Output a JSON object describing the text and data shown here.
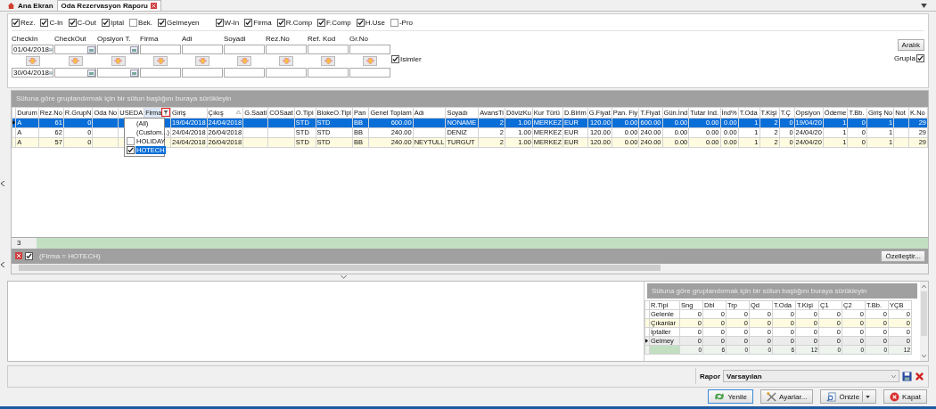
{
  "tabs": [
    {
      "label": "Ana Ekran",
      "kind": "home",
      "selected": false,
      "closable": false
    },
    {
      "label": "Oda Rezervasyon Raporu",
      "kind": "report",
      "selected": true,
      "closable": true
    }
  ],
  "status_groups": [
    {
      "checks": [
        {
          "label": "Rez.",
          "checked": true
        },
        {
          "label": "C-In",
          "checked": true
        },
        {
          "label": "C-Out",
          "checked": true
        },
        {
          "label": "Iptal",
          "checked": true
        },
        {
          "label": "Bek.",
          "checked": false
        },
        {
          "label": "Gelmeyen",
          "checked": true
        }
      ]
    },
    {
      "checks": [
        {
          "label": "W-In",
          "checked": true
        },
        {
          "label": "Firma",
          "checked": true
        },
        {
          "label": "R.Comp",
          "checked": true
        },
        {
          "label": "F.Comp",
          "checked": true
        },
        {
          "label": "H.Use",
          "checked": true
        },
        {
          "label": "-Pro",
          "checked": false
        }
      ]
    }
  ],
  "filters": [
    {
      "label": "CheckIn",
      "kind": "date",
      "from": "01/04/2018",
      "to": "30/04/2018"
    },
    {
      "label": "CheckOut",
      "kind": "date"
    },
    {
      "label": "Opsiyon T.",
      "kind": "date"
    },
    {
      "label": "Firma",
      "kind": "text"
    },
    {
      "label": "Adi",
      "kind": "text"
    },
    {
      "label": "Soyadi",
      "kind": "text"
    },
    {
      "label": "Rez.No",
      "kind": "text"
    },
    {
      "label": "Ref. Kod",
      "kind": "text"
    },
    {
      "label": "Gr.No",
      "kind": "text"
    }
  ],
  "names_check": {
    "label": "Isimler",
    "checked": true
  },
  "range_button": "Aralık",
  "group_check": {
    "label": "Grupla",
    "checked": true
  },
  "grid": {
    "group_hint": "Sütuna göre gruplandırmak için bir sütun başlığını buraya sürükleyin",
    "columns": [
      {
        "label": "Durum",
        "kind": "text",
        "filtered": false,
        "sorted": false
      },
      {
        "label": "Rez.No",
        "kind": "number",
        "filtered": false,
        "sorted": false
      },
      {
        "label": "R.GrupN",
        "kind": "number",
        "filtered": false,
        "sorted": false
      },
      {
        "label": "Oda No",
        "kind": "text",
        "filtered": false,
        "sorted": false
      },
      {
        "label": "USEDA",
        "kind": "text",
        "filtered": false,
        "sorted": false
      },
      {
        "label": "Firma",
        "kind": "text",
        "filtered": true,
        "sorted": false
      },
      {
        "label": "Giriş",
        "kind": "text",
        "filtered": false,
        "sorted": false
      },
      {
        "label": "Çıkış",
        "kind": "text",
        "filtered": false,
        "sorted": true
      },
      {
        "label": "G.Saati",
        "kind": "text",
        "filtered": false,
        "sorted": false
      },
      {
        "label": "COSaat",
        "kind": "text",
        "filtered": false,
        "sorted": false
      },
      {
        "label": "O.Tipi",
        "kind": "text",
        "filtered": false,
        "sorted": false
      },
      {
        "label": "BlokeO.Tipi",
        "kind": "text",
        "filtered": false,
        "sorted": false
      },
      {
        "label": "Pan",
        "kind": "text",
        "filtered": false,
        "sorted": false
      },
      {
        "label": "Genel Toplam",
        "kind": "number",
        "filtered": false,
        "sorted": false
      },
      {
        "label": "Adı",
        "kind": "text",
        "filtered": false,
        "sorted": false
      },
      {
        "label": "Soyadı",
        "kind": "text",
        "filtered": false,
        "sorted": false
      },
      {
        "label": "AvansTi",
        "kind": "number",
        "filtered": false,
        "sorted": false
      },
      {
        "label": "DövizKu",
        "kind": "number",
        "filtered": false,
        "sorted": false
      },
      {
        "label": "Kur Türü",
        "kind": "text",
        "filtered": false,
        "sorted": false
      },
      {
        "label": "D.Birim",
        "kind": "text",
        "filtered": false,
        "sorted": false
      },
      {
        "label": "G.Fiyat",
        "kind": "number",
        "filtered": false,
        "sorted": false
      },
      {
        "label": "Pan. Fiy",
        "kind": "number",
        "filtered": false,
        "sorted": false
      },
      {
        "label": "T.Fiyat",
        "kind": "number",
        "filtered": false,
        "sorted": false
      },
      {
        "label": "Gün.İnd",
        "kind": "number",
        "filtered": false,
        "sorted": false
      },
      {
        "label": "Tutar Ind.",
        "kind": "number",
        "filtered": false,
        "sorted": false
      },
      {
        "label": "İnd%",
        "kind": "number",
        "filtered": false,
        "sorted": false
      },
      {
        "label": "T.Oda",
        "kind": "number",
        "filtered": false,
        "sorted": false
      },
      {
        "label": "T.Kişi",
        "kind": "number",
        "filtered": false,
        "sorted": false
      },
      {
        "label": "T.Ç",
        "kind": "number",
        "filtered": false,
        "sorted": false
      },
      {
        "label": "Opsiyon",
        "kind": "text",
        "filtered": false,
        "sorted": false
      },
      {
        "label": "Ödeme",
        "kind": "number",
        "filtered": false,
        "sorted": false
      },
      {
        "label": "T.Bb.",
        "kind": "number",
        "filtered": false,
        "sorted": false
      },
      {
        "label": "Giriş No",
        "kind": "number",
        "filtered": false,
        "sorted": false
      },
      {
        "label": "Not",
        "kind": "text",
        "filtered": false,
        "sorted": false
      },
      {
        "label": "K.No",
        "kind": "number",
        "filtered": false,
        "sorted": false
      }
    ],
    "rows": [
      {
        "selected": true,
        "cells": [
          "A",
          "61",
          "0",
          null,
          null,
          null,
          "19/04/2018",
          "24/04/2018",
          null,
          null,
          "STD",
          "STD",
          "BB",
          "600.00",
          null,
          "NONAME",
          "2",
          "1.00",
          "MERKEZ",
          "EUR",
          "120.00",
          "0.00",
          "600.00",
          "0.00",
          "0.00",
          "0.00",
          "1",
          "2",
          "0",
          "19/04/20",
          "1",
          "0",
          "1",
          null,
          "29"
        ]
      },
      {
        "selected": false,
        "cells": [
          "A",
          "62",
          "0",
          null,
          null,
          null,
          "24/04/2018",
          "26/04/2018",
          null,
          null,
          "STD",
          "STD",
          "BB",
          "240.00",
          null,
          "DENIZ",
          "2",
          "1.00",
          "MERKEZ",
          "EUR",
          "120.00",
          "0.00",
          "240.00",
          "0.00",
          "0.00",
          "0.00",
          "1",
          "2",
          "0",
          "24/04/20",
          "1",
          "0",
          "1",
          null,
          "29"
        ]
      },
      {
        "selected": false,
        "cells": [
          "A",
          "57",
          "0",
          null,
          null,
          null,
          "24/04/2018",
          "26/04/2018",
          null,
          null,
          "STD",
          "STD",
          "BB",
          "240.00",
          "NEYTULL",
          "TURGUT",
          "2",
          "1.00",
          "MERKEZ",
          "EUR",
          "120.00",
          "0.00",
          "240.00",
          "0.00",
          "0.00",
          "0.00",
          "1",
          "2",
          "0",
          "24/04/20",
          "1",
          "0",
          "1",
          null,
          "29"
        ]
      }
    ],
    "row_count": "3",
    "filter_dropdown": {
      "items": [
        {
          "label": "(All)",
          "kind": "option",
          "selected": false
        },
        {
          "label": "(Custom...)",
          "kind": "option",
          "selected": false
        },
        {
          "label": "HOLIDAY",
          "kind": "check",
          "checked": false,
          "selected": false
        },
        {
          "label": "HOTECH",
          "kind": "check",
          "checked": true,
          "selected": true
        }
      ]
    },
    "filter": {
      "enabled": true,
      "text": "(Firma = HOTECH)"
    },
    "customize_button": "Özelleştir..."
  },
  "summary": {
    "group_hint": "Sütuna göre gruplandırmak için bir sütun başlığını buraya sürükleyin",
    "columns": [
      "R.Tipi",
      "Sng",
      "Dbl",
      "Trp",
      "Qd",
      "T.Oda",
      "T.Kişi",
      "Ç1",
      "Ç2",
      "T.Bb.",
      "YÇB"
    ],
    "rows": [
      {
        "selected": false,
        "cells": [
          "Gelenle",
          "0",
          "0",
          "0",
          "0",
          "0",
          "0",
          "0",
          "0",
          "0",
          "0"
        ]
      },
      {
        "selected": false,
        "cells": [
          "Çıkanlar",
          "0",
          "0",
          "0",
          "0",
          "0",
          "0",
          "0",
          "0",
          "0",
          "0"
        ]
      },
      {
        "selected": false,
        "cells": [
          "İptaller",
          "0",
          "0",
          "0",
          "0",
          "0",
          "0",
          "0",
          "0",
          "0",
          "0"
        ]
      },
      {
        "selected": true,
        "cells": [
          "Gelmey",
          "0",
          "0",
          "0",
          "0",
          "0",
          "0",
          "0",
          "0",
          "0",
          "0"
        ]
      }
    ],
    "totals": [
      "0",
      "6",
      "0",
      "0",
      "6",
      "12",
      "0",
      "0",
      "0",
      "12"
    ]
  },
  "report": {
    "label": "Rapor",
    "value": "Varsayılan"
  },
  "buttons": [
    {
      "label": "Yenile",
      "kind": "refresh",
      "focused": true,
      "menu": false
    },
    {
      "label": "Ayarlar...",
      "kind": "settings",
      "focused": false,
      "menu": false
    },
    {
      "label": "Önizle",
      "kind": "preview",
      "focused": false,
      "menu": true
    },
    {
      "label": "Kapat",
      "kind": "close",
      "focused": false,
      "menu": false
    }
  ]
}
